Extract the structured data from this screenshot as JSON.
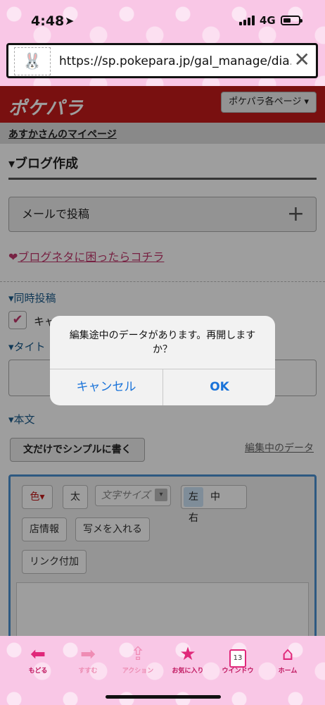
{
  "status_bar": {
    "time": "4:48",
    "network": "4G"
  },
  "browser": {
    "url": "https://sp.pokepara.jp/gal_manage/dia...",
    "close_label": "✕"
  },
  "header": {
    "brand": "ポケパラ",
    "menu_label": "ポケパラ各ページ ▾"
  },
  "mypage_link": "あすかさんのマイページ",
  "section_title": "▾ブログ作成",
  "mail_post": {
    "label": "メールで投稿",
    "icon": "plus-icon"
  },
  "neta_link": {
    "heart": "❤",
    "text": "ブログネタに困ったらコチラ"
  },
  "simultaneous": {
    "title": "▾同時投稿",
    "checkbox_label": "キャ"
  },
  "title_section": {
    "title": "▾タイト"
  },
  "body_section": {
    "title": "▾本文",
    "simple_button": "文だけでシンプルに書く",
    "editing_data_link": "編集中のデータ"
  },
  "editor_toolbar": {
    "color": "色▾",
    "bold": "太",
    "font_size": "文字サイズ",
    "align_left": "左",
    "align_center": "中",
    "align_right": "右",
    "shop_info": "店情報",
    "insert_photo": "写メを入れる",
    "add_link": "リンク付加"
  },
  "dialog": {
    "message": "編集途中のデータがあります。再開しますか？",
    "cancel": "キャンセル",
    "ok": "OK"
  },
  "bottom_nav": [
    {
      "label": "もどる",
      "icon": "arrow-left-icon"
    },
    {
      "label": "すすむ",
      "icon": "arrow-right-icon"
    },
    {
      "label": "アクション",
      "icon": "share-icon"
    },
    {
      "label": "お気に入り",
      "icon": "star-icon"
    },
    {
      "label": "ウインドウ",
      "icon": "window-icon",
      "count": "13"
    },
    {
      "label": "ホーム",
      "icon": "home-icon"
    }
  ],
  "colors": {
    "accent_red": "#c41a1a",
    "pink": "#e0287a",
    "link_blue": "#1a73d9"
  }
}
